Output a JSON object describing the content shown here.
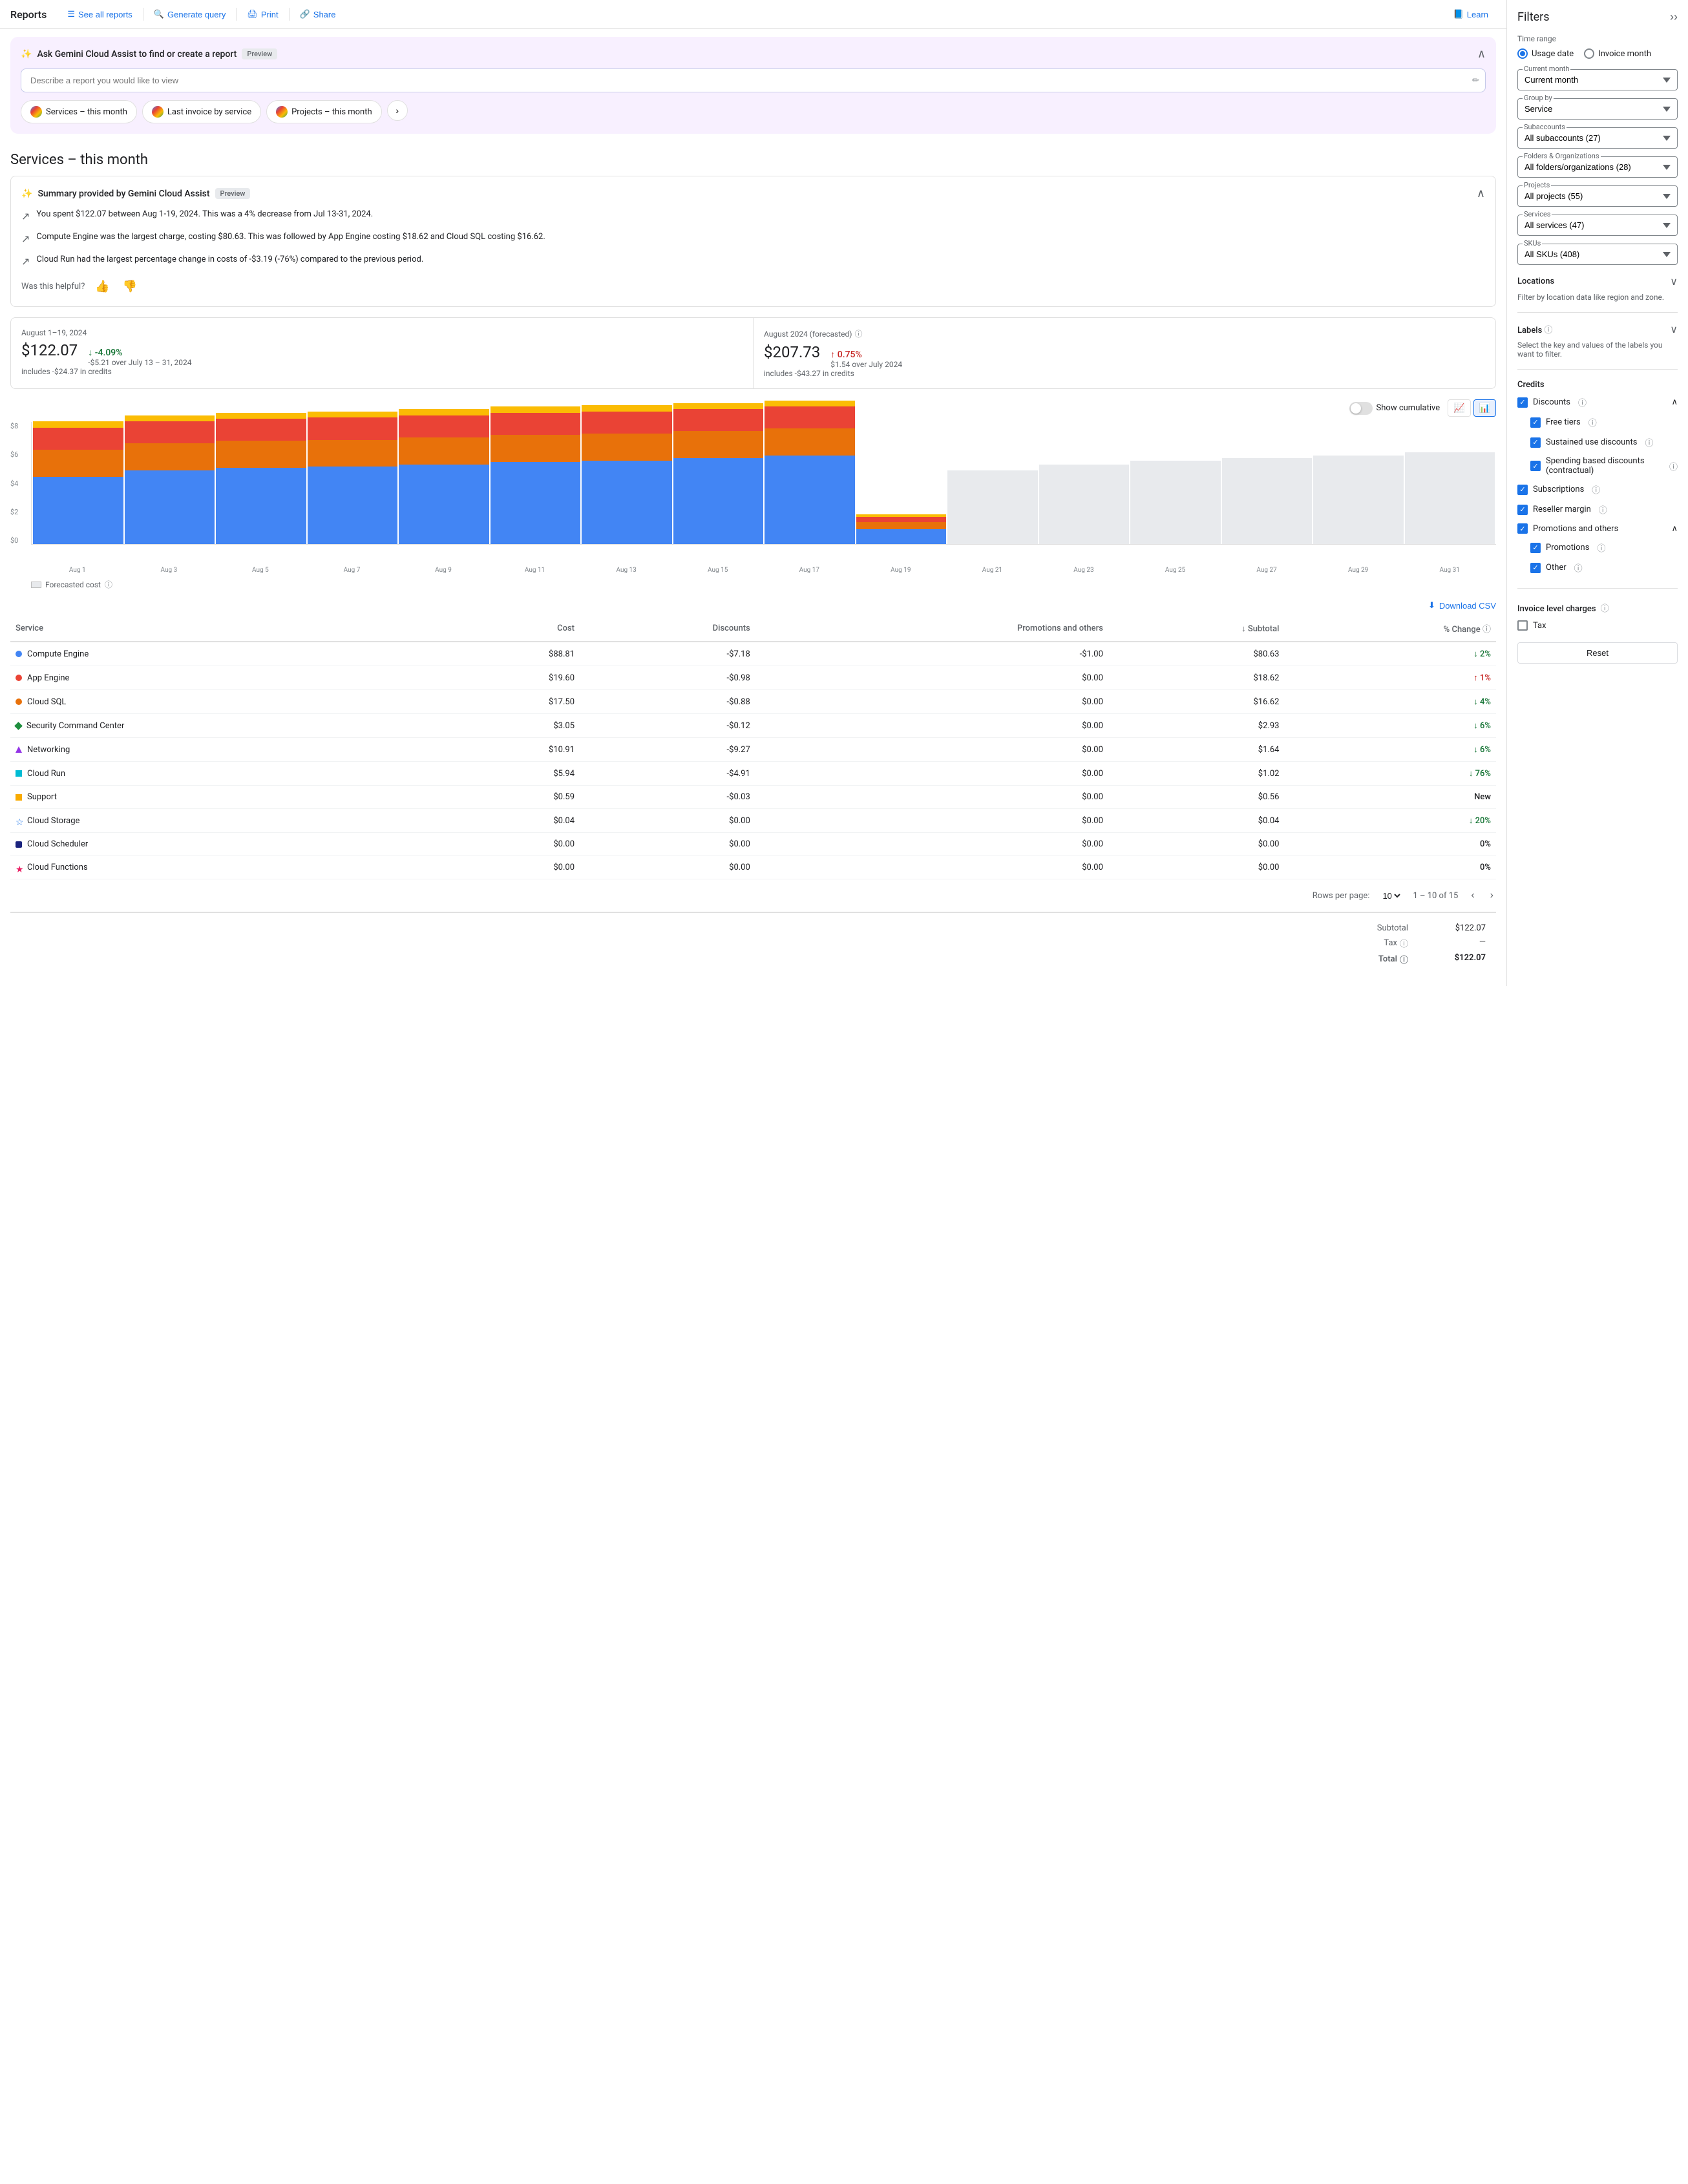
{
  "topnav": {
    "title": "Reports",
    "see_all_reports": "See all reports",
    "generate_query": "Generate query",
    "print": "Print",
    "share": "Share",
    "learn": "Learn"
  },
  "gemini": {
    "title": "Ask Gemini Cloud Assist to find or create a report",
    "preview_badge": "Preview",
    "input_placeholder": "Describe a report you would like to view",
    "chips": [
      {
        "label": "Services – this month"
      },
      {
        "label": "Last invoice by service"
      },
      {
        "label": "Projects – this month"
      }
    ]
  },
  "page": {
    "title": "Services – this month"
  },
  "summary": {
    "title": "Summary provided by Gemini Cloud Assist",
    "preview_badge": "Preview",
    "lines": [
      "You spent $122.07 between Aug 1-19, 2024. This was a 4% decrease from Jul 13-31, 2024.",
      "Compute Engine was the largest charge, costing $80.63. This was followed by App Engine costing $18.62 and Cloud SQL costing $16.62.",
      "Cloud Run had the largest percentage change in costs of -$3.19 (-76%) compared to the previous period."
    ],
    "helpful_label": "Was this helpful?"
  },
  "metrics": {
    "current": {
      "period": "August 1–19, 2024",
      "value": "$122.07",
      "sub": "includes -$24.37 in credits",
      "change": "↓ -4.09%",
      "change_type": "down",
      "change_sub": "-$5.21 over July 13 – 31, 2024"
    },
    "forecasted": {
      "period": "August 2024 (forecasted)",
      "value": "$207.73",
      "sub": "includes -$43.27 in credits",
      "change": "↑ 0.75%",
      "change_type": "up",
      "change_sub": "$1.54 over July 2024"
    }
  },
  "chart": {
    "show_cumulative": "Show cumulative",
    "y_labels": [
      "$8",
      "$6",
      "$4",
      "$2",
      "$0"
    ],
    "x_labels": [
      "Aug 1",
      "Aug 3",
      "Aug 5",
      "Aug 7",
      "Aug 9",
      "Aug 11",
      "Aug 13",
      "Aug 15",
      "Aug 17",
      "Aug 19",
      "Aug 21",
      "Aug 23",
      "Aug 25",
      "Aug 27",
      "Aug 29",
      "Aug 31"
    ],
    "bars": [
      {
        "blue": 55,
        "orange": 22,
        "red": 18,
        "yellow": 5,
        "forecast": 0
      },
      {
        "blue": 60,
        "orange": 22,
        "red": 18,
        "yellow": 5,
        "forecast": 0
      },
      {
        "blue": 62,
        "orange": 22,
        "red": 18,
        "yellow": 5,
        "forecast": 0
      },
      {
        "blue": 63,
        "orange": 22,
        "red": 18,
        "yellow": 5,
        "forecast": 0
      },
      {
        "blue": 65,
        "orange": 22,
        "red": 18,
        "yellow": 5,
        "forecast": 0
      },
      {
        "blue": 67,
        "orange": 22,
        "red": 18,
        "yellow": 5,
        "forecast": 0
      },
      {
        "blue": 68,
        "orange": 22,
        "red": 18,
        "yellow": 5,
        "forecast": 0
      },
      {
        "blue": 70,
        "orange": 22,
        "red": 18,
        "yellow": 5,
        "forecast": 0
      },
      {
        "blue": 72,
        "orange": 22,
        "red": 18,
        "yellow": 5,
        "forecast": 0
      },
      {
        "blue": 12,
        "orange": 6,
        "red": 4,
        "yellow": 2,
        "forecast": 0
      },
      {
        "blue": 0,
        "orange": 0,
        "red": 0,
        "yellow": 0,
        "forecast": 60
      },
      {
        "blue": 0,
        "orange": 0,
        "red": 0,
        "yellow": 0,
        "forecast": 65
      },
      {
        "blue": 0,
        "orange": 0,
        "red": 0,
        "yellow": 0,
        "forecast": 68
      },
      {
        "blue": 0,
        "orange": 0,
        "red": 0,
        "yellow": 0,
        "forecast": 70
      },
      {
        "blue": 0,
        "orange": 0,
        "red": 0,
        "yellow": 0,
        "forecast": 72
      },
      {
        "blue": 0,
        "orange": 0,
        "red": 0,
        "yellow": 0,
        "forecast": 75
      }
    ],
    "forecasted_legend": "Forecasted cost"
  },
  "table": {
    "download_csv": "Download CSV",
    "headers": [
      "Service",
      "Cost",
      "Discounts",
      "Promotions and others",
      "↓ Subtotal",
      "% Change"
    ],
    "rows": [
      {
        "service": "Compute Engine",
        "dot": "blue",
        "cost": "$88.81",
        "discounts": "-$7.18",
        "promotions": "-$1.00",
        "subtotal": "$80.63",
        "change": "↓ 2%",
        "change_type": "down"
      },
      {
        "service": "App Engine",
        "dot": "red",
        "cost": "$19.60",
        "discounts": "-$0.98",
        "promotions": "$0.00",
        "subtotal": "$18.62",
        "change": "↑ 1%",
        "change_type": "up"
      },
      {
        "service": "Cloud SQL",
        "dot": "orange",
        "cost": "$17.50",
        "discounts": "-$0.88",
        "promotions": "$0.00",
        "subtotal": "$16.62",
        "change": "↓ 4%",
        "change_type": "down"
      },
      {
        "service": "Security Command Center",
        "dot": "teal",
        "cost": "$3.05",
        "discounts": "-$0.12",
        "promotions": "$0.00",
        "subtotal": "$2.93",
        "change": "↓ 6%",
        "change_type": "down"
      },
      {
        "service": "Networking",
        "dot": "purple",
        "cost": "$10.91",
        "discounts": "-$9.27",
        "promotions": "$0.00",
        "subtotal": "$1.64",
        "change": "↓ 6%",
        "change_type": "down"
      },
      {
        "service": "Cloud Run",
        "dot": "cyan",
        "cost": "$5.94",
        "discounts": "-$4.91",
        "promotions": "$0.00",
        "subtotal": "$1.02",
        "change": "↓ 76%",
        "change_type": "down_big"
      },
      {
        "service": "Support",
        "dot": "gold",
        "cost": "$0.59",
        "discounts": "-$0.03",
        "promotions": "$0.00",
        "subtotal": "$0.56",
        "change": "New",
        "change_type": "neutral"
      },
      {
        "service": "Cloud Storage",
        "dot": "star",
        "cost": "$0.04",
        "discounts": "$0.00",
        "promotions": "$0.00",
        "subtotal": "$0.04",
        "change": "↓ 20%",
        "change_type": "down"
      },
      {
        "service": "Cloud Scheduler",
        "dot": "navy",
        "cost": "$0.00",
        "discounts": "$0.00",
        "promotions": "$0.00",
        "subtotal": "$0.00",
        "change": "0%",
        "change_type": "neutral"
      },
      {
        "service": "Cloud Functions",
        "dot": "pink",
        "cost": "$0.00",
        "discounts": "$0.00",
        "promotions": "$0.00",
        "subtotal": "$0.00",
        "change": "0%",
        "change_type": "neutral"
      }
    ],
    "pagination": {
      "rows_per_page": "Rows per page:",
      "rows_count": "10",
      "range": "1 – 10 of 15"
    },
    "totals": {
      "subtotal_label": "Subtotal",
      "subtotal_value": "$122.07",
      "tax_label": "Tax",
      "tax_value": "—",
      "total_label": "Total",
      "total_value": "$122.07"
    }
  },
  "filters": {
    "title": "Filters",
    "time_range_label": "Time range",
    "usage_date_label": "Usage date",
    "invoice_month_label": "Invoice month",
    "current_month_label": "Current month",
    "group_by_label": "Group by",
    "group_by_value": "Service",
    "subaccounts_label": "Subaccounts",
    "subaccounts_value": "All subaccounts (27)",
    "folders_label": "Folders & Organizations",
    "folders_value": "All folders/organizations (28)",
    "projects_label": "Projects",
    "projects_value": "All projects (55)",
    "services_label": "Services",
    "services_value": "All services (47)",
    "skus_label": "SKUs",
    "skus_value": "All SKUs (408)",
    "locations_label": "Locations",
    "locations_desc": "Filter by location data like region and zone.",
    "labels_label": "Labels",
    "labels_desc": "Select the key and values of the labels you want to filter.",
    "credits_label": "Credits",
    "discounts_label": "Discounts",
    "free_tiers_label": "Free tiers",
    "sustained_use_label": "Sustained use discounts",
    "spending_based_label": "Spending based discounts (contractual)",
    "subscriptions_label": "Subscriptions",
    "reseller_label": "Reseller margin",
    "promotions_others_label": "Promotions and others",
    "promotions_label": "Promotions",
    "other_label": "Other",
    "invoice_charges_label": "Invoice level charges",
    "tax_label": "Tax",
    "reset_label": "Reset"
  }
}
